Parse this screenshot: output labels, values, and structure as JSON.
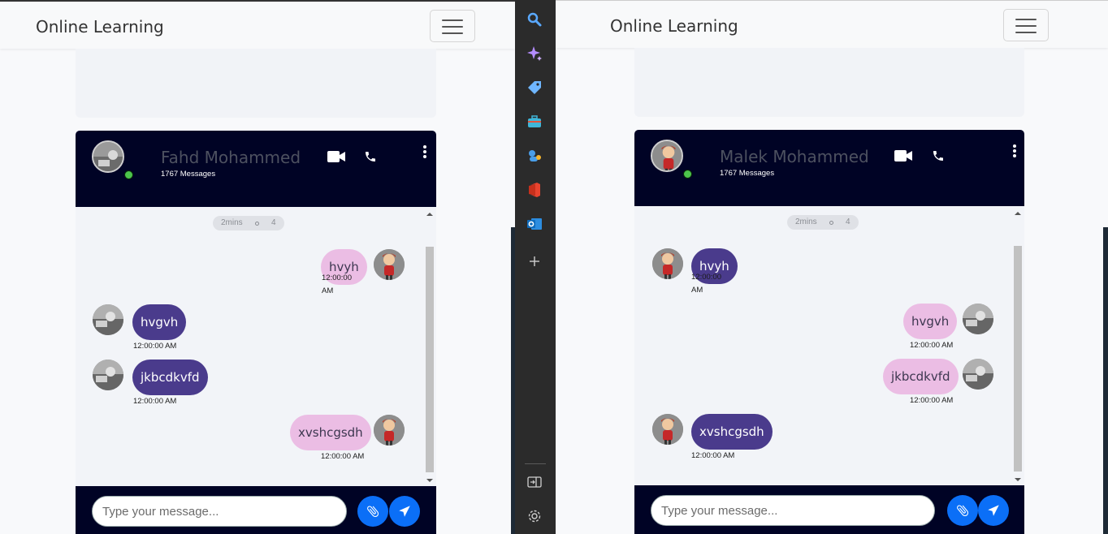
{
  "left": {
    "brand": "Online Learning",
    "contact": {
      "name": "Fahd Mohammed",
      "messages": "1767 Messages"
    },
    "time_pill": {
      "ago": "2mins",
      "count": "4"
    },
    "messages": [
      {
        "text": "hvyh",
        "time": "12:00:00 AM",
        "side": "right",
        "color": "pink"
      },
      {
        "text": "hvgvh",
        "time": "12:00:00 AM",
        "side": "left",
        "color": "purple"
      },
      {
        "text": "jkbcdkvfd",
        "time": "12:00:00 AM",
        "side": "left",
        "color": "purple"
      },
      {
        "text": "xvshcgsdh",
        "time": "12:00:00 AM",
        "side": "right",
        "color": "pink"
      }
    ],
    "input_placeholder": "Type your message..."
  },
  "right": {
    "brand": "Online Learning",
    "contact": {
      "name": "Malek Mohammed",
      "messages": "1767 Messages"
    },
    "time_pill": {
      "ago": "2mins",
      "count": "4"
    },
    "messages": [
      {
        "text": "hvyh",
        "time": "12:00:00 AM",
        "side": "left",
        "color": "purple"
      },
      {
        "text": "hvgvh",
        "time": "12:00:00 AM",
        "side": "right",
        "color": "pink"
      },
      {
        "text": "jkbcdkvfd",
        "time": "12:00:00 AM",
        "side": "right",
        "color": "pink"
      },
      {
        "text": "xvshcgsdh",
        "time": "12:00:00 AM",
        "side": "left",
        "color": "purple"
      }
    ],
    "input_placeholder": "Type your message..."
  },
  "sidebar_icons": [
    "search-icon",
    "copilot-sparkle-icon",
    "shopping-tag-icon",
    "tools-briefcase-icon",
    "games-icon",
    "office-icon",
    "outlook-icon",
    "add-icon",
    "split-screen-icon",
    "settings-icon"
  ],
  "colors": {
    "chat_header": "#000325",
    "bubble_pink": "#ebbde4",
    "bubble_purple": "#4a3b8c",
    "accent_blue": "#0b6ff7",
    "online_green": "#4cc44c"
  }
}
